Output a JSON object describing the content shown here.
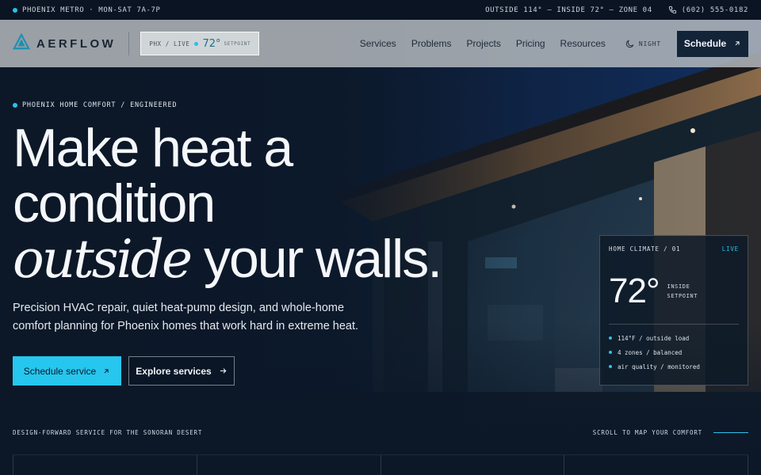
{
  "topbar": {
    "location": "PHOENIX METRO · MON-SAT 7A-7P",
    "status": "OUTSIDE 114° — INSIDE 72° — ZONE 04",
    "phone": "(602) 555-0182"
  },
  "nav": {
    "brand": "AERFLOW",
    "live_chip": {
      "label": "PHX / LIVE",
      "temp": "72°",
      "sub": "SETPOINT"
    },
    "links": [
      "Services",
      "Problems",
      "Projects",
      "Pricing",
      "Resources"
    ],
    "theme_toggle": "NIGHT",
    "cta": "Schedule"
  },
  "hero": {
    "eyebrow": "PHOENIX HOME COMFORT / ENGINEERED",
    "headline": {
      "line1": "Make heat a",
      "line2": "condition",
      "italic": "outside",
      "line3_rest": " your walls."
    },
    "subcopy": "Precision HVAC repair, quiet heat-pump design, and whole-home comfort planning for Phoenix homes that work hard in extreme heat.",
    "primary_cta": "Schedule service",
    "secondary_cta": "Explore services"
  },
  "climate_card": {
    "title": "HOME CLIMATE / 01",
    "status": "LIVE",
    "temp": "72°",
    "temp_label_1": "INSIDE",
    "temp_label_2": "SETPOINT",
    "stats": [
      "114°F / outside load",
      "4 zones / balanced",
      "air quality / monitored"
    ]
  },
  "footer_strip": {
    "tagline": "DESIGN-FORWARD SERVICE FOR THE SONORAN DESERT",
    "scroll_hint": "SCROLL TO MAP YOUR COMFORT"
  },
  "colors": {
    "accent": "#27c6ee",
    "navy": "#132338",
    "background": "#0d1826"
  },
  "icons": {
    "logo": "triangle-logo-icon",
    "phone": "phone-icon",
    "night": "moon-icon",
    "arrow_up_right": "arrow-up-right-icon",
    "arrow_right": "arrow-right-icon"
  }
}
